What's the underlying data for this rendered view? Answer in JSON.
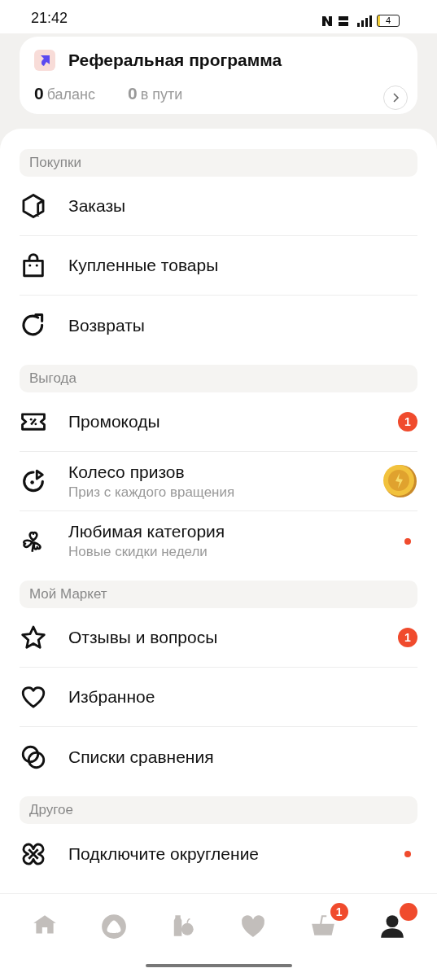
{
  "status_bar": {
    "time": "21:42",
    "battery": "4"
  },
  "referral": {
    "title": "Реферальная программа",
    "stats": [
      {
        "value": "0",
        "label": "баланс",
        "muted": false
      },
      {
        "value": "0",
        "label": "в пути",
        "muted": true
      }
    ]
  },
  "sections": [
    {
      "title": "Покупки",
      "items": [
        {
          "label": "Заказы"
        },
        {
          "label": "Купленные товары"
        },
        {
          "label": "Возвраты"
        }
      ]
    },
    {
      "title": "Выгода",
      "items": [
        {
          "label": "Промокоды",
          "trailing": {
            "kind": "count",
            "text": "1"
          }
        },
        {
          "label": "Колесо призов",
          "sublabel": "Приз с каждого вращения",
          "trailing": {
            "kind": "coin"
          }
        },
        {
          "label": "Любимая категория",
          "sublabel": "Новые скидки недели",
          "trailing": {
            "kind": "dot"
          }
        }
      ]
    },
    {
      "title": "Мой Маркет",
      "items": [
        {
          "label": "Отзывы и вопросы",
          "trailing": {
            "kind": "count",
            "text": "1"
          }
        },
        {
          "label": "Избранное"
        },
        {
          "label": "Списки сравнения"
        }
      ]
    },
    {
      "title": "Другое",
      "items": [
        {
          "label": "Подключите округление",
          "trailing": {
            "kind": "dot"
          }
        }
      ]
    }
  ],
  "bottom_nav": [
    {
      "selected": false
    },
    {
      "selected": false
    },
    {
      "selected": false
    },
    {
      "selected": false
    },
    {
      "selected": false,
      "badge": {
        "kind": "count",
        "text": "1"
      }
    },
    {
      "selected": true,
      "badge": {
        "kind": "dot"
      }
    }
  ]
}
